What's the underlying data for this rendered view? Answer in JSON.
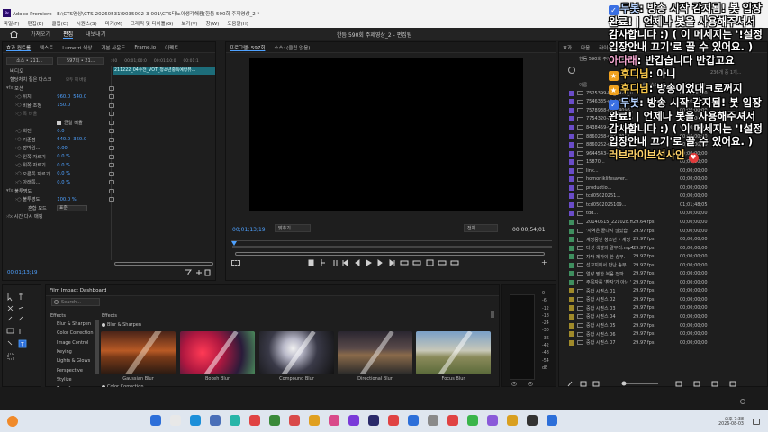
{
  "window": {
    "title": "Adobe Premiere - E:\\CTS영상\\CTS-20260531\\9035002-3-001\\CTS타노이생각해용[한듬 590회 주제영상_2 *",
    "menu": [
      "파일(F)",
      "편집(E)",
      "클립(C)",
      "시퀀스(S)",
      "마커(M)",
      "그래픽 및 타이틀(G)",
      "보기(V)",
      "창(W)",
      "도움말(H)"
    ]
  },
  "workspace": {
    "tabs": [
      "가져오기",
      "편집",
      "내보내기"
    ],
    "active": "편집",
    "center_title": "한듬 590회 주제영상_2 - 편집됨"
  },
  "effect_controls": {
    "tabs": [
      "효과 컨트롤",
      "텍스트",
      "Lumetri 색상",
      "기본 사운드",
      "Frame.io",
      "이펙트"
    ],
    "master": "소스 • 211...",
    "sequence": "597회 • 21...",
    "ruler": [
      ":00",
      "00:01;00:0",
      "00:01:10:0",
      "00:01:1"
    ],
    "clip_name": "211222_04수전_VOT_청소년중독예방뮤...",
    "section_video": "비디오",
    "rows": [
      {
        "label": "혈당처치 절은 마스크",
        "v1": "",
        "v2": "",
        "note": "모두 꺼 버림"
      },
      {
        "label": "모션",
        "v1": "",
        "v2": ""
      },
      {
        "label": "위치",
        "v1": "960.0",
        "v2": "540.0"
      },
      {
        "label": "비율 조정",
        "v1": "150.0",
        "v2": ""
      },
      {
        "label": "폭 비율",
        "v1": "",
        "v2": ""
      },
      {
        "label": "균일 비율",
        "v1": "",
        "v2": ""
      },
      {
        "label": "회전",
        "v1": "0.0",
        "v2": ""
      },
      {
        "label": "기준점",
        "v1": "640.0",
        "v2": "360.0"
      },
      {
        "label": "깜박임...",
        "v1": "0.00",
        "v2": ""
      },
      {
        "label": "왼쪽 자르기",
        "v1": "0.0 %",
        "v2": ""
      },
      {
        "label": "위쪽 자르기",
        "v1": "0.0 %",
        "v2": ""
      },
      {
        "label": "오른쪽 자르기",
        "v1": "0.0 %",
        "v2": ""
      },
      {
        "label": "아래쪽...",
        "v1": "0.0 %",
        "v2": ""
      },
      {
        "label": "불투명도",
        "v1": "",
        "v2": ""
      },
      {
        "label": "불투명도",
        "v1": "100.0 %",
        "v2": ""
      },
      {
        "label": "혼합 모드",
        "v1": "표준",
        "v2": ""
      },
      {
        "label": "시간 다시 매핑",
        "v1": "",
        "v2": ""
      }
    ],
    "timecode": "00;01;13;19"
  },
  "program": {
    "tabs": [
      "프로그램: 597회",
      "소스: (클립 없음)"
    ],
    "timecode_left": "00;01;13;19",
    "fit": "맞추기",
    "quality": "전체",
    "timecode_right": "00;00;54;01"
  },
  "project": {
    "tabs": [
      "효과",
      "다음",
      "라이브러리"
    ],
    "bin": "한듬 590회 주제영상_2.prproj",
    "count": "236개 중 1개...",
    "columns": [
      "이름",
      "프레임 속도",
      "미디어 시작"
    ],
    "rows": [
      {
        "color": "#6a4cc8",
        "name": "7525399-hd_1920_1080",
        "fps": "",
        "dur": "00;00;00;00"
      },
      {
        "color": "#6a4cc8",
        "name": "7546335-uhd_3840...",
        "fps": "",
        "dur": "00;00;00;00"
      },
      {
        "color": "#6a4cc8",
        "name": "7578938-uhd_4096_216",
        "fps": "",
        "dur": "00;00;00;00"
      },
      {
        "color": "#6a4cc8",
        "name": "7754320-hd_1920_108",
        "fps": "",
        "dur": "00;00;00;00"
      },
      {
        "color": "#6a4cc8",
        "name": "8438459-uhd_3840_216",
        "fps": "",
        "dur": "00;00;00;00"
      },
      {
        "color": "#6a4cc8",
        "name": "8860238-uhd_4096_216",
        "fps": "",
        "dur": "00;00;00;00"
      },
      {
        "color": "#6a4cc8",
        "name": "8860262-uhd_3840_216",
        "fps": "",
        "dur": "00;00;00;00"
      },
      {
        "color": "#6a4cc8",
        "name": "9644543-uhd_3840_216",
        "fps": "",
        "dur": "00;00;00;00"
      },
      {
        "color": "#6a4cc8",
        "name": "15870...",
        "fps": "",
        "dur": "00;00;00;00"
      },
      {
        "color": "#6a4cc8",
        "name": "link...",
        "fps": "",
        "dur": "00;00;00;00"
      },
      {
        "color": "#6a4cc8",
        "name": "homoniklifesaver...",
        "fps": "",
        "dur": "00;00;00;00"
      },
      {
        "color": "#6a4cc8",
        "name": "productio...",
        "fps": "",
        "dur": "00;00;00;00"
      },
      {
        "color": "#6a4cc8",
        "name": "tcd05020251...",
        "fps": "",
        "dur": "00;00;00;00"
      },
      {
        "color": "#6a4cc8",
        "name": "tcd0502025109...",
        "fps": "",
        "dur": "01;01;48;05"
      },
      {
        "color": "#6a4cc8",
        "name": "tdd...",
        "fps": "",
        "dur": "00;00;00;00"
      },
      {
        "color": "#3f8f5f",
        "name": "20140515_221028.mp4",
        "fps": "29.64 fps",
        "dur": "00;00;00;00"
      },
      {
        "color": "#3f8f5f",
        "name": "'사역은 끝나지 않았습",
        "fps": "29.97 fps",
        "dur": "00;00;00;00"
      },
      {
        "color": "#3f8f5f",
        "name": "계명중인 청소년 • 계명",
        "fps": "29.97 fps",
        "dur": "00;00;00;00"
      },
      {
        "color": "#3f8f5f",
        "name": "다섯 색깔의 갈무리.mp4",
        "fps": "29.97 fps",
        "dur": "00;00;00;00"
      },
      {
        "color": "#3f8f5f",
        "name": "자막 제작이 한 송부.",
        "fps": "29.97 fps",
        "dur": "00;00;00;00"
      },
      {
        "color": "#3f8f5f",
        "name": "선교지에서 만난 송부.",
        "fps": "29.97 fps",
        "dur": "00;00;00;00"
      },
      {
        "color": "#3f8f5f",
        "name": "얼랑 찡한 복음 전파...",
        "fps": "29.97 fps",
        "dur": "00;00;00;00"
      },
      {
        "color": "#3f8f5f",
        "name": "주목자를 '환자'가 아닌 '",
        "fps": "29.97 fps",
        "dur": "00;00;00;00"
      },
      {
        "color": "#a08a2a",
        "name": "중합 시퀀스 01",
        "fps": "29.97 fps",
        "dur": "00;00;00;00"
      },
      {
        "color": "#a08a2a",
        "name": "중합 시퀀스 02",
        "fps": "29.97 fps",
        "dur": "00;00;00;00"
      },
      {
        "color": "#a08a2a",
        "name": "중합 시퀀스 03",
        "fps": "29.97 fps",
        "dur": "00;00;00;00"
      },
      {
        "color": "#a08a2a",
        "name": "중합 시퀀스 04",
        "fps": "29.97 fps",
        "dur": "00;00;00;00"
      },
      {
        "color": "#a08a2a",
        "name": "중합 시퀀스 05",
        "fps": "29.97 fps",
        "dur": "00;00;00;00"
      },
      {
        "color": "#a08a2a",
        "name": "중합 시퀀스 06",
        "fps": "29.97 fps",
        "dur": "00;00;00;00"
      },
      {
        "color": "#a08a2a",
        "name": "중합 시퀀스 07",
        "fps": "29.97 fps",
        "dur": "00;00;00;00"
      }
    ]
  },
  "chat": [
    {
      "nick": "두봇",
      "text": "방송 시작 감지됨! 봇 입장 완료! | 언제나 봇을 사용해주셔서 감사합니다 :) ( 이 메세지는 '!설정 입장안내 끄기'로 끌 수 있어요. )",
      "badge": "bot"
    },
    {
      "nick": "아다래",
      "text": "반갑습니다 반갑고요",
      "badge": ""
    },
    {
      "nick": "후디님",
      "text": "아니",
      "badge": "y"
    },
    {
      "nick": "후디님",
      "text": "방송이었대ㅋ로꺼지",
      "badge": "y"
    },
    {
      "nick": "두봇",
      "text": "방송 시작 감지됨! 봇 입장 완료! | 언제나 봇을 사용해주셔서 감사합니다 :) ( 이 메세지는 '!설정 입장안내 끄기'로 끌 수 있어요. )",
      "badge": "bot"
    },
    {
      "nick": "",
      "text": "러브라이브선사인",
      "badge": "heart"
    }
  ],
  "tools_panel": {},
  "fid": {
    "title": "Film Impact Dashboard",
    "search_placeholder": "Search...",
    "effects_heading": "Effects",
    "categories": [
      "Blur & Sharpen",
      "Color Correction",
      "Image Control",
      "Keying",
      "Lights & Glows",
      "Perspective",
      "Stylize",
      "Transform"
    ],
    "main_heading": "Effects",
    "sub_heading": "Blur & Sharpen",
    "thumbs": [
      "Gaussian Blur",
      "Bokeh Blur",
      "Compound Blur",
      "Directional Blur",
      "Focus Blur"
    ],
    "next_heading": "Color Correction"
  },
  "meter": {
    "scale": [
      "0",
      "-6",
      "-12",
      "-18",
      "-24",
      "-30",
      "-36",
      "-42",
      "-48",
      "-54",
      "dB"
    ],
    "bottom": [
      "S",
      "S"
    ]
  },
  "taskbar": {
    "weather_temp": "",
    "time": "오후 7:38",
    "date": "2026-08-03"
  }
}
